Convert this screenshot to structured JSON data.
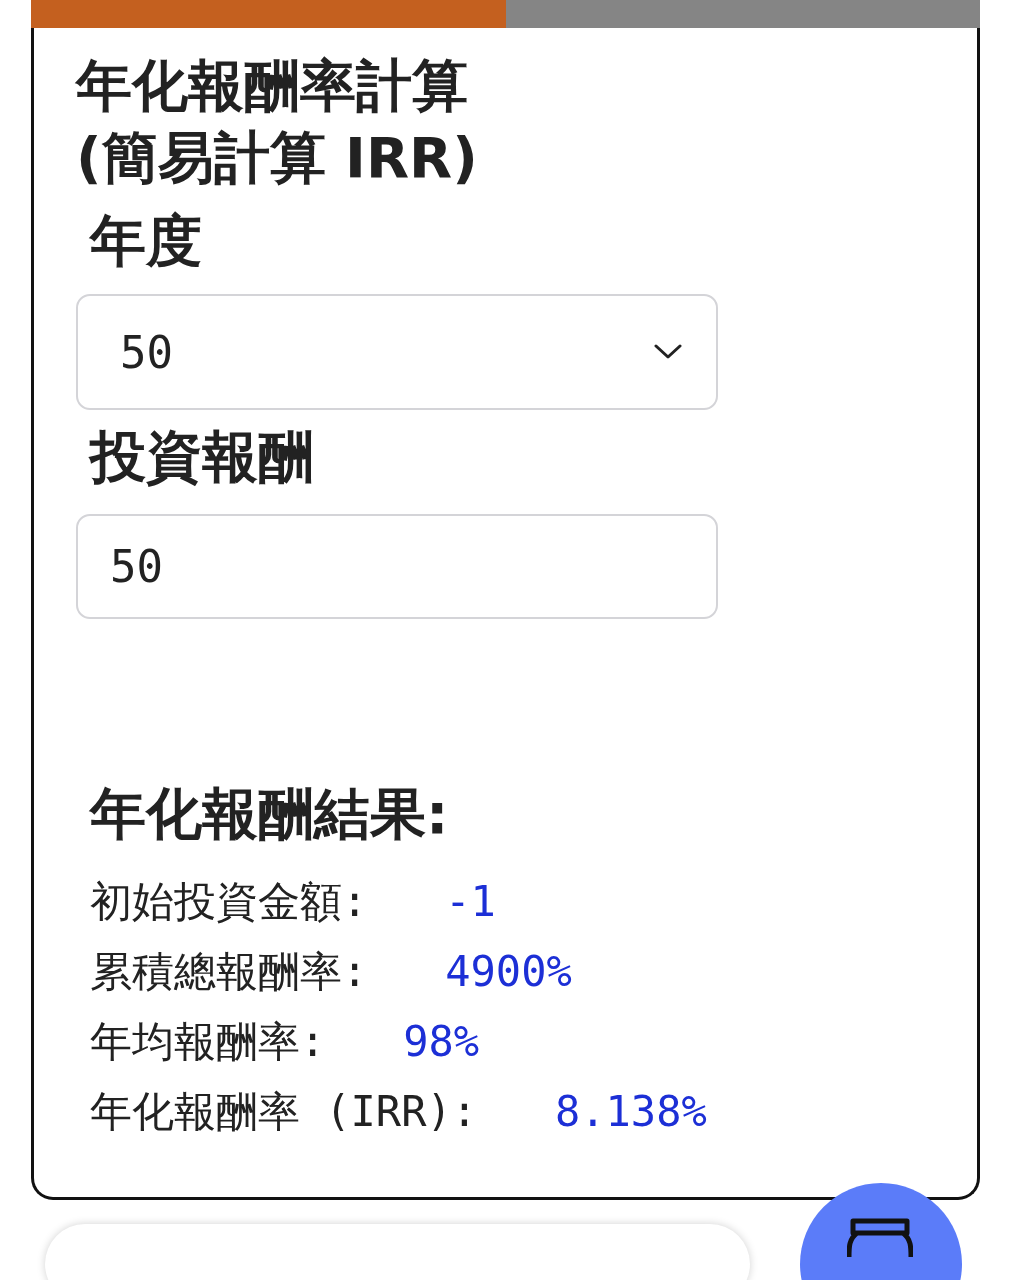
{
  "progress": {
    "level": 0.5
  },
  "calculator": {
    "title_lines": [
      "年化報酬率計算",
      "(簡易計算 IRR)"
    ],
    "fields": [
      {
        "kind": "select",
        "label": "年度",
        "value": "50"
      },
      {
        "kind": "input",
        "label": "投資報酬",
        "value": "50"
      }
    ],
    "results": {
      "heading": "年化報酬結果:",
      "rows": [
        {
          "label": "初始投資金額:",
          "value": "-1"
        },
        {
          "label": "累積總報酬率:",
          "value": "4900%"
        },
        {
          "label": "年均報酬率:",
          "value": "98%"
        },
        {
          "label": "年化報酬率 (IRR):",
          "value": "8.138%"
        }
      ]
    }
  }
}
